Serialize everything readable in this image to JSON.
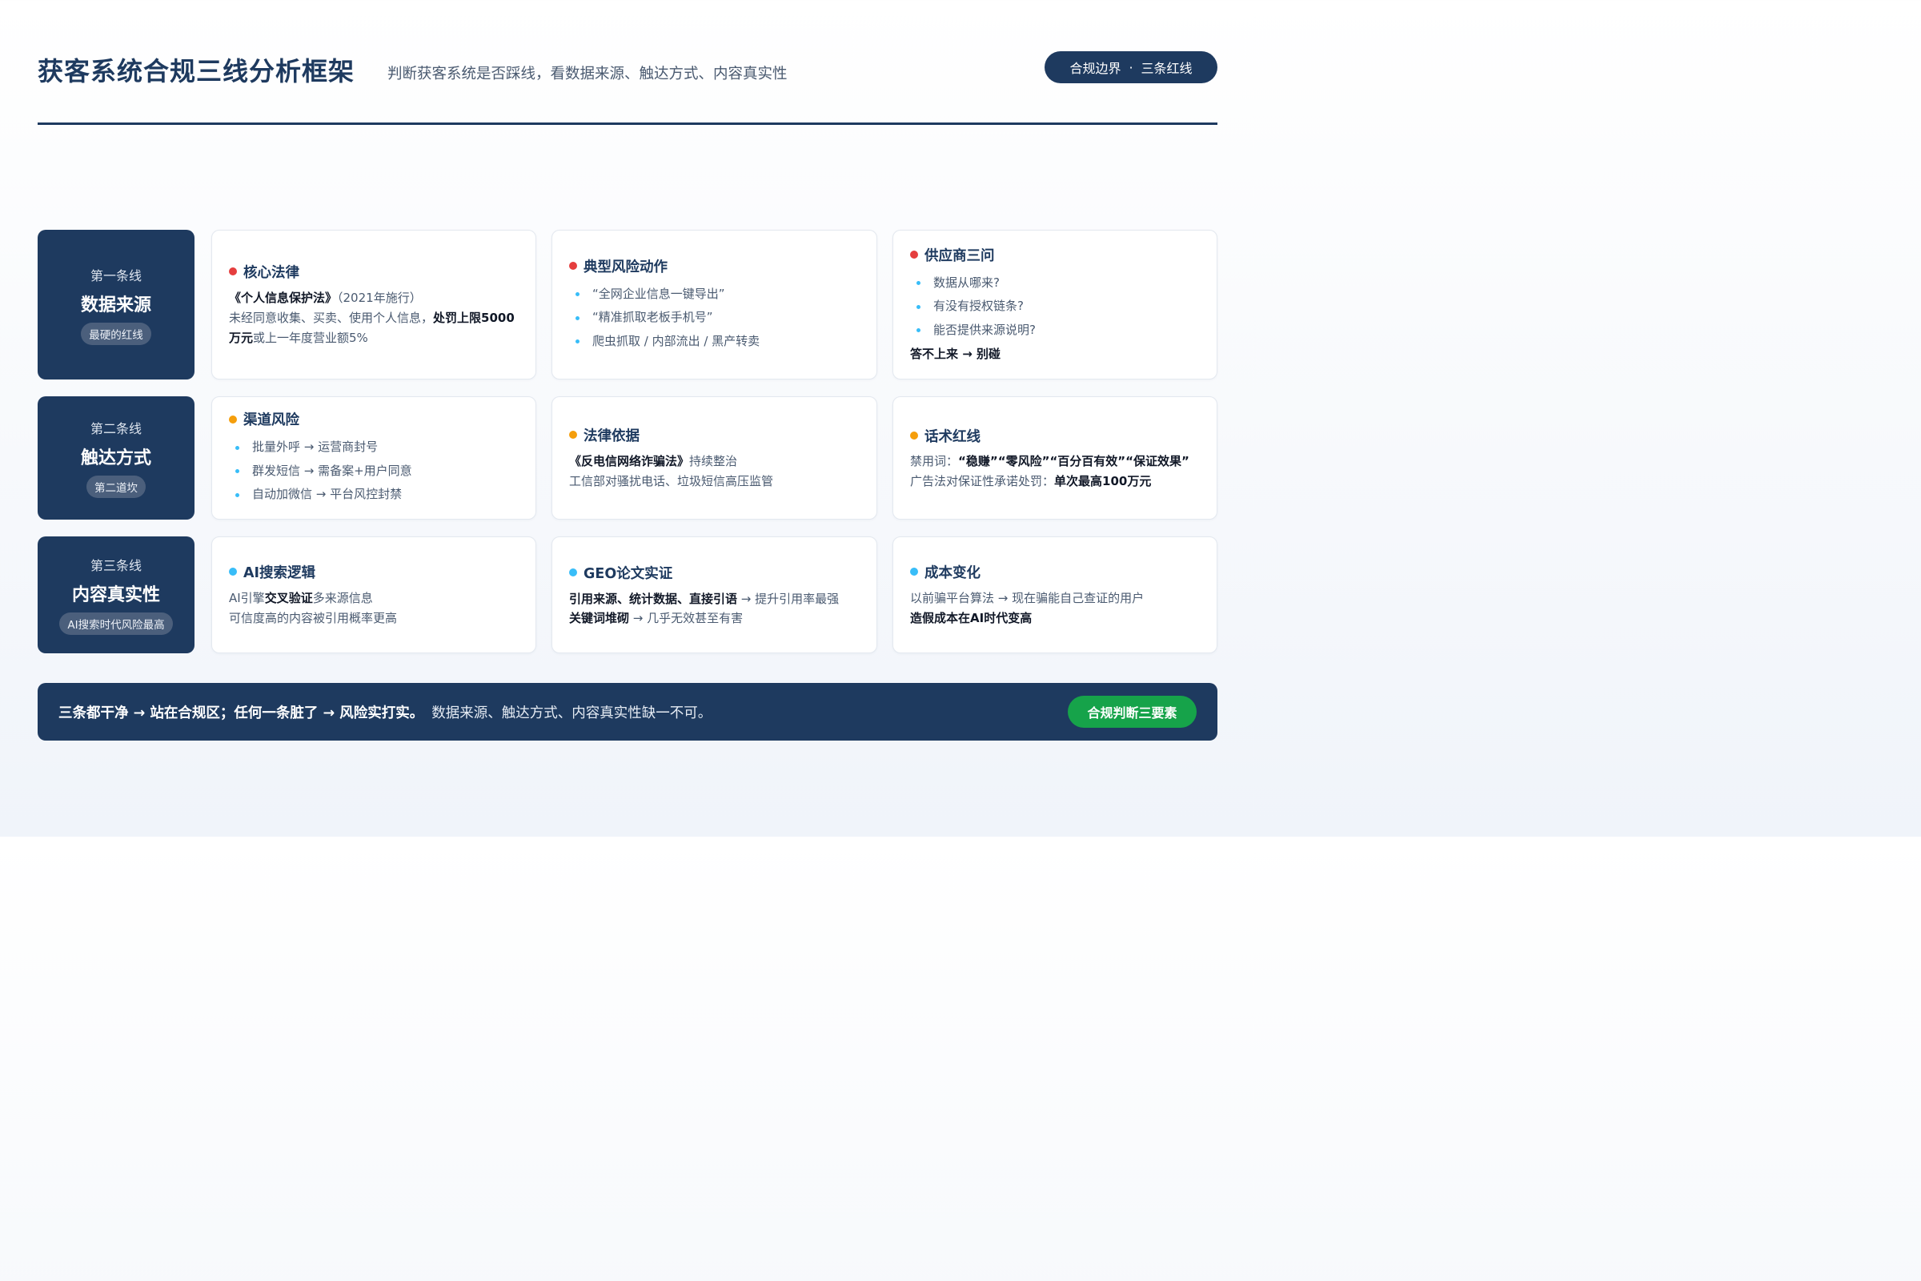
{
  "header": {
    "title": "获客系统合规三线分析框架",
    "subtitle": "判断获客系统是否踩线，看数据来源、触达方式、内容真实性",
    "pill_left": "合规边界",
    "pill_sep": "·",
    "pill_right": "三条红线"
  },
  "rows": [
    {
      "label": {
        "num": "第一条线",
        "name": "数据来源",
        "tag": "最硬的红线"
      },
      "cards": [
        {
          "title": "核心法律",
          "dot": "red",
          "law": "《个人信息保护法》",
          "law_rest": "（2021年施行）",
          "line2a": "未经同意收集、买卖、使用个人信息，",
          "line2b": "处罚上限5000万元",
          "line2c": "或上一年度营业额5%"
        },
        {
          "title": "典型风险动作",
          "dot": "red",
          "bullets": [
            "“全网企业信息一键导出”",
            "“精准抓取老板手机号”",
            "爬虫抓取 / 内部流出 / 黑产转卖"
          ]
        },
        {
          "title": "供应商三问",
          "dot": "red",
          "bullets": [
            "数据从哪来?",
            "有没有授权链条?",
            "能否提供来源说明?"
          ],
          "strong": "答不上来 → 别碰"
        }
      ]
    },
    {
      "label": {
        "num": "第二条线",
        "name": "触达方式",
        "tag": "第二道坎"
      },
      "cards": [
        {
          "title": "渠道风险",
          "dot": "orange",
          "bullets": [
            "批量外呼 → 运营商封号",
            "群发短信 → 需备案+用户同意",
            "自动加微信 → 平台风控封禁"
          ]
        },
        {
          "title": "法律依据",
          "dot": "orange",
          "law": "《反电信网络诈骗法》",
          "law_rest": "持续整治",
          "line2": "工信部对骚扰电话、垃圾短信高压监管"
        },
        {
          "title": "话术红线",
          "dot": "orange",
          "prefix": "禁用词：",
          "banned": "“稳赚”“零风险”“百分百有效”“保证效果”",
          "line2a": "广告法对保证性承诺处罚：",
          "line2b": "单次最高100万元"
        }
      ]
    },
    {
      "label": {
        "num": "第三条线",
        "name": "内容真实性",
        "tag": "AI搜索时代风险最高"
      },
      "cards": [
        {
          "title": "AI搜索逻辑",
          "dot": "blue",
          "line1a": "AI引擎",
          "line1b": "交叉验证",
          "line1c": "多来源信息",
          "line2": "可信度高的内容被引用概率更高"
        },
        {
          "title": "GEO论文实证",
          "dot": "blue",
          "line1a": "引用来源、统计数据、直接引语",
          "line1b": " → 提升引用率最强",
          "line2a": "关键词堆砌",
          "line2b": " → 几乎无效甚至有害"
        },
        {
          "title": "成本变化",
          "dot": "blue",
          "line1": "以前骗平台算法 → 现在骗能自己查证的用户",
          "line2": "造假成本在AI时代变高"
        }
      ]
    }
  ],
  "footer": {
    "main": "三条都干净 → 站在合规区；任何一条脏了 → 风险实打实。",
    "rest": "数据来源、触达方式、内容真实性缺一不可。",
    "button": "合规判断三要素"
  },
  "colors": {
    "navy": "#1e3a5f",
    "red": "#e53e3e",
    "orange": "#f59e0b",
    "blue": "#38bdf8",
    "green": "#16a34a"
  }
}
